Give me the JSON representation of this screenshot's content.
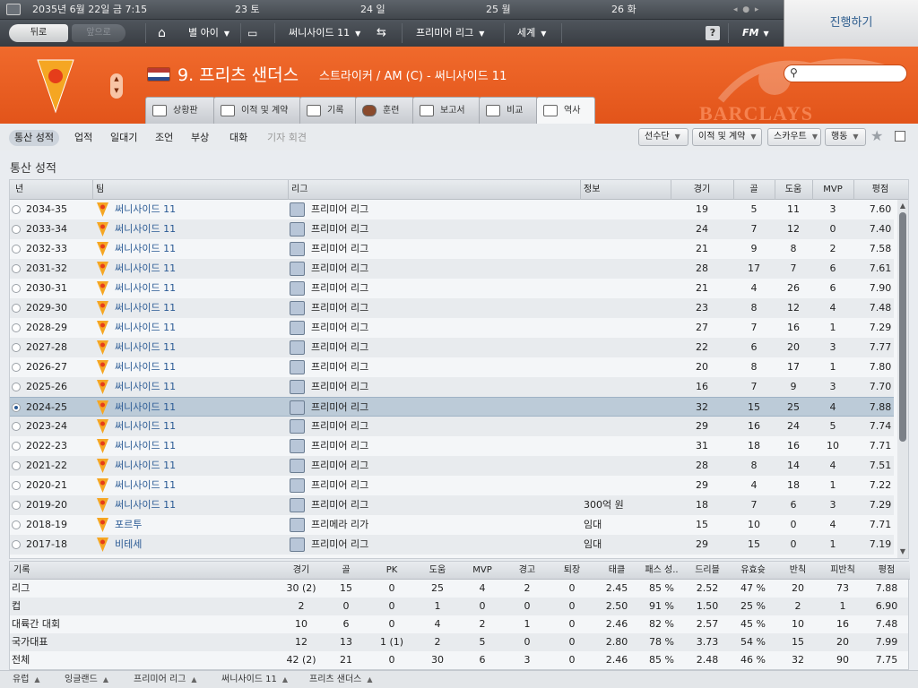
{
  "topbar": {
    "datetime": "2035년 6월 22일 금 7:15",
    "days": [
      "23 토",
      "24 일",
      "25 월",
      "26 화"
    ],
    "back": "뒤로",
    "forward": "앞으로",
    "nav": {
      "club": "별 아이",
      "team": "써니사이드 11",
      "league": "프리미어 리그",
      "world": "세계"
    },
    "help": "?",
    "fm": "FM",
    "continue": "진행하기"
  },
  "player": {
    "number_name": "9. 프리츠 샌더스",
    "info": "스트라이커 / AM (C) - 써니사이드 11",
    "watermark": "BARCLAYS"
  },
  "tabs": [
    "상황판",
    "이적 및 계약",
    "기록",
    "훈련",
    "보고서",
    "비교",
    "역사"
  ],
  "subnav": {
    "items": [
      "통산 성적",
      "업적",
      "일대기",
      "조언",
      "부상",
      "대화",
      "기자 회견"
    ],
    "dropdowns": [
      "선수단",
      "이적 및 계약",
      "스카우트",
      "행동"
    ]
  },
  "section_title": "통산 성적",
  "career": {
    "headers": {
      "year": "년",
      "team": "팀",
      "league": "리그",
      "info": "정보",
      "apps": "경기",
      "goals": "골",
      "assists": "도움",
      "mvp": "MVP",
      "rating": "평점"
    },
    "rows": [
      {
        "year": "2034-35",
        "team": "써니사이드 11",
        "league": "프리미어 리그",
        "info": "",
        "apps": "19",
        "goals": "5",
        "assists": "11",
        "mvp": "3",
        "rating": "7.60"
      },
      {
        "year": "2033-34",
        "team": "써니사이드 11",
        "league": "프리미어 리그",
        "info": "",
        "apps": "24",
        "goals": "7",
        "assists": "12",
        "mvp": "0",
        "rating": "7.40"
      },
      {
        "year": "2032-33",
        "team": "써니사이드 11",
        "league": "프리미어 리그",
        "info": "",
        "apps": "21",
        "goals": "9",
        "assists": "8",
        "mvp": "2",
        "rating": "7.58"
      },
      {
        "year": "2031-32",
        "team": "써니사이드 11",
        "league": "프리미어 리그",
        "info": "",
        "apps": "28",
        "goals": "17",
        "assists": "7",
        "mvp": "6",
        "rating": "7.61"
      },
      {
        "year": "2030-31",
        "team": "써니사이드 11",
        "league": "프리미어 리그",
        "info": "",
        "apps": "21",
        "goals": "4",
        "assists": "26",
        "mvp": "6",
        "rating": "7.90"
      },
      {
        "year": "2029-30",
        "team": "써니사이드 11",
        "league": "프리미어 리그",
        "info": "",
        "apps": "23",
        "goals": "8",
        "assists": "12",
        "mvp": "4",
        "rating": "7.48"
      },
      {
        "year": "2028-29",
        "team": "써니사이드 11",
        "league": "프리미어 리그",
        "info": "",
        "apps": "27",
        "goals": "7",
        "assists": "16",
        "mvp": "1",
        "rating": "7.29"
      },
      {
        "year": "2027-28",
        "team": "써니사이드 11",
        "league": "프리미어 리그",
        "info": "",
        "apps": "22",
        "goals": "6",
        "assists": "20",
        "mvp": "3",
        "rating": "7.77"
      },
      {
        "year": "2026-27",
        "team": "써니사이드 11",
        "league": "프리미어 리그",
        "info": "",
        "apps": "20",
        "goals": "8",
        "assists": "17",
        "mvp": "1",
        "rating": "7.80"
      },
      {
        "year": "2025-26",
        "team": "써니사이드 11",
        "league": "프리미어 리그",
        "info": "",
        "apps": "16",
        "goals": "7",
        "assists": "9",
        "mvp": "3",
        "rating": "7.70"
      },
      {
        "year": "2024-25",
        "team": "써니사이드 11",
        "league": "프리미어 리그",
        "info": "",
        "apps": "32",
        "goals": "15",
        "assists": "25",
        "mvp": "4",
        "rating": "7.88"
      },
      {
        "year": "2023-24",
        "team": "써니사이드 11",
        "league": "프리미어 리그",
        "info": "",
        "apps": "29",
        "goals": "16",
        "assists": "24",
        "mvp": "5",
        "rating": "7.74"
      },
      {
        "year": "2022-23",
        "team": "써니사이드 11",
        "league": "프리미어 리그",
        "info": "",
        "apps": "31",
        "goals": "18",
        "assists": "16",
        "mvp": "10",
        "rating": "7.71"
      },
      {
        "year": "2021-22",
        "team": "써니사이드 11",
        "league": "프리미어 리그",
        "info": "",
        "apps": "28",
        "goals": "8",
        "assists": "14",
        "mvp": "4",
        "rating": "7.51"
      },
      {
        "year": "2020-21",
        "team": "써니사이드 11",
        "league": "프리미어 리그",
        "info": "",
        "apps": "29",
        "goals": "4",
        "assists": "18",
        "mvp": "1",
        "rating": "7.22"
      },
      {
        "year": "2019-20",
        "team": "써니사이드 11",
        "league": "프리미어 리그",
        "info": "300억 원",
        "apps": "18",
        "goals": "7",
        "assists": "6",
        "mvp": "3",
        "rating": "7.29"
      },
      {
        "year": "2018-19",
        "team": "포르투",
        "league": "프리메라 리가",
        "info": "임대",
        "apps": "15",
        "goals": "10",
        "assists": "0",
        "mvp": "4",
        "rating": "7.71"
      },
      {
        "year": "2017-18",
        "team": "비테세",
        "league": "프리미어 리그",
        "info": "임대",
        "apps": "29",
        "goals": "15",
        "assists": "0",
        "mvp": "1",
        "rating": "7.19"
      }
    ]
  },
  "totals": {
    "headers": [
      "기록",
      "경기",
      "골",
      "PK",
      "도움",
      "MVP",
      "경고",
      "퇴장",
      "태클",
      "패스 성..",
      "드리블",
      "유효슛",
      "반칙",
      "피반칙",
      "평점"
    ],
    "rows": [
      [
        "리그",
        "30 (2)",
        "15",
        "0",
        "25",
        "4",
        "2",
        "0",
        "2.45",
        "85 %",
        "2.52",
        "47 %",
        "20",
        "73",
        "7.88"
      ],
      [
        "컵",
        "2",
        "0",
        "0",
        "1",
        "0",
        "0",
        "0",
        "2.50",
        "91 %",
        "1.50",
        "25 %",
        "2",
        "1",
        "6.90"
      ],
      [
        "대륙간 대회",
        "10",
        "6",
        "0",
        "4",
        "2",
        "1",
        "0",
        "2.46",
        "82 %",
        "2.57",
        "45 %",
        "10",
        "16",
        "7.48"
      ],
      [
        "국가대표",
        "12",
        "13",
        "1 (1)",
        "2",
        "5",
        "0",
        "0",
        "2.80",
        "78 %",
        "3.73",
        "54 %",
        "15",
        "20",
        "7.99"
      ],
      [
        "전체",
        "42 (2)",
        "21",
        "0",
        "30",
        "6",
        "3",
        "0",
        "2.46",
        "85 %",
        "2.48",
        "46 %",
        "32",
        "90",
        "7.75"
      ]
    ]
  },
  "footer": [
    "유럽",
    "잉글랜드",
    "프리미어 리그",
    "써니사이드 11",
    "프리츠 샌더스"
  ],
  "selected_row": 10,
  "colors": {
    "accent": "#e8591f",
    "link": "#2a5a94",
    "selected": "#bccbd8"
  }
}
